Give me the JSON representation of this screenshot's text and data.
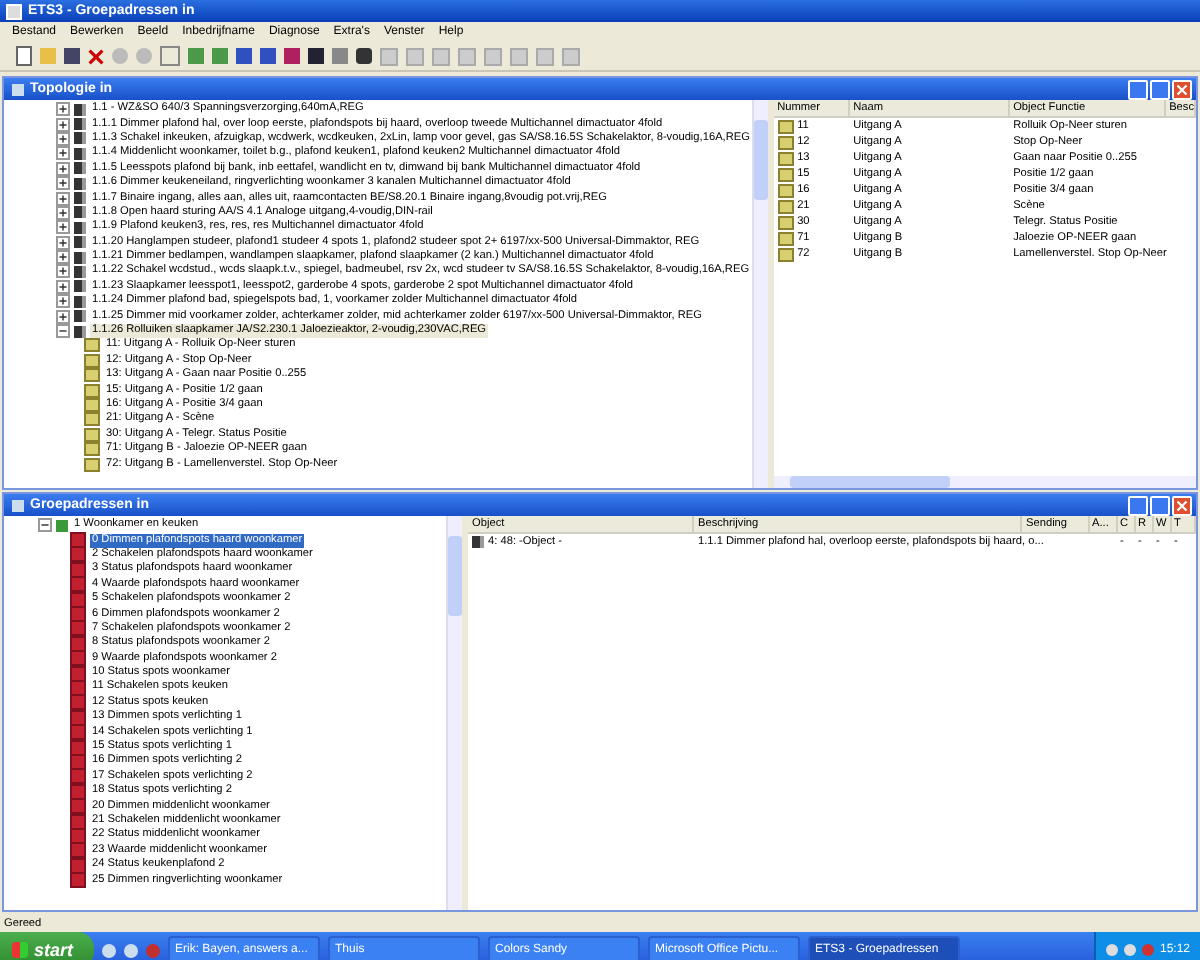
{
  "window": {
    "title": "ETS3 - Groepadressen in"
  },
  "menu": [
    "Bestand",
    "Bewerken",
    "Beeld",
    "Inbedrijfname",
    "Diagnose",
    "Extra's",
    "Venster",
    "Help"
  ],
  "topology": {
    "title": "Topologie in",
    "tree": [
      {
        "label": "1.1 - WZ&SO 640/3 Spanningsverzorging,640mA,REG",
        "expanded": false,
        "selected": false
      },
      {
        "label": "1.1.1 Dimmer plafond hal, over loop eerste, plafondspots bij haard, overloop tweede Multichannel dimactuator 4fold",
        "expanded": false,
        "selected": false
      },
      {
        "label": "1.1.3 Schakel inkeuken, afzuigkap, wcdwerk, wcdkeuken, 2xLin, lamp voor gevel, gas SA/S8.16.5S Schakelaktor, 8-voudig,16A,REG",
        "expanded": false,
        "selected": false
      },
      {
        "label": "1.1.4 Middenlicht woonkamer, toilet b.g., plafond keuken1, plafond keuken2 Multichannel dimactuator 4fold",
        "expanded": false,
        "selected": false
      },
      {
        "label": "1.1.5 Leesspots plafond bij bank, inb eettafel, wandlicht en tv, dimwand bij bank Multichannel dimactuator 4fold",
        "expanded": false,
        "selected": false
      },
      {
        "label": "1.1.6 Dimmer keukeneiland, ringverlichting woonkamer 3 kanalen Multichannel dimactuator 4fold",
        "expanded": false,
        "selected": false
      },
      {
        "label": "1.1.7 Binaire ingang, alles aan, alles uit, raamcontacten BE/S8.20.1 Binaire ingang,8voudig pot.vrij,REG",
        "expanded": false,
        "selected": false
      },
      {
        "label": "1.1.8 Open haard sturing AA/S 4.1 Analoge uitgang,4-voudig,DIN-rail",
        "expanded": false,
        "selected": false
      },
      {
        "label": "1.1.9 Plafond keuken3, res, res, res Multichannel dimactuator 4fold",
        "expanded": false,
        "selected": false
      },
      {
        "label": "1.1.20 Hanglampen studeer, plafond1 studeer 4 spots 1, plafond2 studeer spot 2+ 6197/xx-500 Universal-Dimmaktor, REG",
        "expanded": false,
        "selected": false
      },
      {
        "label": "1.1.21 Dimmer bedlampen, wandlampen slaapkamer, plafond slaapkamer (2 kan.) Multichannel dimactuator 4fold",
        "expanded": false,
        "selected": false
      },
      {
        "label": "1.1.22 Schakel wcdstud., wcds slaapk.t.v., spiegel, badmeubel, rsv 2x, wcd studeer tv SA/S8.16.5S Schakelaktor, 8-voudig,16A,REG",
        "expanded": false,
        "selected": false
      },
      {
        "label": "1.1.23 Slaapkamer leesspot1, leesspot2, garderobe 4 spots, garderobe 2 spot Multichannel dimactuator 4fold",
        "expanded": false,
        "selected": false
      },
      {
        "label": "1.1.24 Dimmer plafond bad, spiegelspots bad, 1, voorkamer zolder Multichannel dimactuator 4fold",
        "expanded": false,
        "selected": false
      },
      {
        "label": "1.1.25 Dimmer mid voorkamer zolder, achterkamer zolder, mid achterkamer zolder 6197/xx-500 Universal-Dimmaktor, REG",
        "expanded": false,
        "selected": false
      },
      {
        "label": "1.1.26 Rolluiken slaapkamer JA/S2.230.1 Jaloezieaktor, 2-voudig,230VAC,REG",
        "expanded": true,
        "selected": true,
        "children": [
          {
            "label": "11: Uitgang A - Rolluik Op-Neer sturen",
            "selected": false
          },
          {
            "label": "12: Uitgang A - Stop Op-Neer",
            "selected": false
          },
          {
            "label": "13: Uitgang A - Gaan naar Positie 0..255",
            "selected": false
          },
          {
            "label": "15: Uitgang A - Positie 1/2 gaan",
            "selected": false
          },
          {
            "label": "16: Uitgang A - Positie 3/4 gaan",
            "selected": false
          },
          {
            "label": "21: Uitgang A - Scène",
            "selected": false
          },
          {
            "label": "30: Uitgang A - Telegr. Status Positie",
            "selected": false
          },
          {
            "label": "71: Uitgang B - Jaloezie OP-NEER gaan",
            "selected": false
          },
          {
            "label": "72: Uitgang B - Lamellenverstel. Stop Op-Neer",
            "selected": false
          }
        ]
      }
    ],
    "list": {
      "columns": [
        "Nummer",
        "Naam",
        "Object Functie",
        "Besc"
      ],
      "rows": [
        [
          "11",
          "Uitgang A",
          "Rolluik Op-Neer sturen"
        ],
        [
          "12",
          "Uitgang A",
          "Stop Op-Neer"
        ],
        [
          "13",
          "Uitgang A",
          "Gaan naar Positie 0..255"
        ],
        [
          "15",
          "Uitgang A",
          "Positie 1/2 gaan"
        ],
        [
          "16",
          "Uitgang A",
          "Positie 3/4 gaan"
        ],
        [
          "21",
          "Uitgang A",
          "Scène"
        ],
        [
          "30",
          "Uitgang A",
          "Telegr. Status Positie"
        ],
        [
          "71",
          "Uitgang B",
          "Jaloezie OP-NEER gaan"
        ],
        [
          "72",
          "Uitgang B",
          "Lamellenverstel. Stop Op-Neer"
        ]
      ]
    }
  },
  "group_addresses": {
    "title": "Groepadressen in",
    "tree": [
      {
        "label": "1 Woonkamer en keuken",
        "expanded": true,
        "children": [
          {
            "label": "0 Dimmen plafondspots haard woonkamer",
            "selected": true
          },
          {
            "label": "2 Schakelen plafondspots haard woonkamer",
            "selected": false
          },
          {
            "label": "3 Status plafondspots haard woonkamer",
            "selected": false
          },
          {
            "label": "4 Waarde plafondspots haard woonkamer",
            "selected": false
          },
          {
            "label": "5 Schakelen plafondspots woonkamer 2",
            "selected": false
          },
          {
            "label": "6 Dimmen plafondspots woonkamer 2",
            "selected": false
          },
          {
            "label": "7 Schakelen plafondspots woonkamer 2",
            "selected": false
          },
          {
            "label": "8 Status plafondspots woonkamer 2",
            "selected": false
          },
          {
            "label": "9 Waarde plafondspots woonkamer 2",
            "selected": false
          },
          {
            "label": "10 Status spots woonkamer",
            "selected": false
          },
          {
            "label": "11 Schakelen spots keuken",
            "selected": false
          },
          {
            "label": "12 Status spots keuken",
            "selected": false
          },
          {
            "label": "13 Dimmen spots verlichting 1",
            "selected": false
          },
          {
            "label": "14 Schakelen spots verlichting 1",
            "selected": false
          },
          {
            "label": "15 Status spots verlichting 1",
            "selected": false
          },
          {
            "label": "16 Dimmen spots verlichting 2",
            "selected": false
          },
          {
            "label": "17 Schakelen spots verlichting 2",
            "selected": false
          },
          {
            "label": "18 Status spots verlichting 2",
            "selected": false
          },
          {
            "label": "20 Dimmen middenlicht woonkamer",
            "selected": false
          },
          {
            "label": "21 Schakelen middenlicht woonkamer",
            "selected": false
          },
          {
            "label": "22 Status middenlicht woonkamer",
            "selected": false
          },
          {
            "label": "23 Waarde middenlicht woonkamer",
            "selected": false
          },
          {
            "label": "24 Status keukenplafond 2",
            "selected": false
          },
          {
            "label": "25 Dimmen ringverlichting woonkamer",
            "selected": false
          }
        ]
      }
    ],
    "table": {
      "columns": [
        "Object",
        "Beschrijving",
        "Sending",
        "A...",
        "C",
        "R",
        "W",
        "T"
      ],
      "rows": [
        [
          "4: 48: -Object -",
          "1.1.1 Dimmer plafond hal, overloop eerste, plafondspots bij haard, o...",
          "",
          "",
          "-",
          "-",
          "-",
          "-"
        ]
      ]
    }
  },
  "status_bar": {
    "text": "Gereed"
  },
  "taskbar": {
    "start": "start",
    "items": [
      {
        "label": "Erik: Bayen, answers a...",
        "selected": false
      },
      {
        "label": "Thuis",
        "selected": false
      },
      {
        "label": "Colors Sandy",
        "selected": false
      },
      {
        "label": "Microsoft Office Pictu...",
        "selected": false
      },
      {
        "label": "ETS3 - Groepadressen",
        "selected": true
      }
    ],
    "clock": "15:12"
  }
}
